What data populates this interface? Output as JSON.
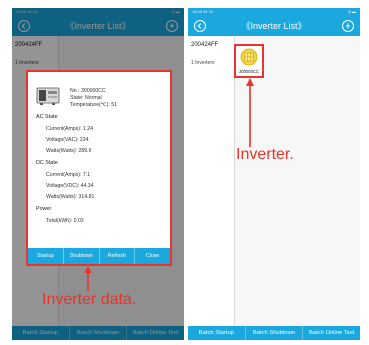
{
  "status_bar": {
    "time": "16:08 54 34 ",
    "right_icons": "· ◘ ▬"
  },
  "title": "《Inverter List》",
  "sidebar": {
    "group_id": "200424FF",
    "count_label": "1 Inverters"
  },
  "dialog": {
    "no": "No.: 300000CC",
    "state": "State: Normal",
    "temperature": "Temperature(℃): 51",
    "ac_state_title": "AC State",
    "ac_current": "Current(Amps): 1.24",
    "ac_voltage": "Voltage(VAC): 234",
    "ac_watts": "Watts(Watts): 289.6",
    "dc_state_title": "DC State",
    "dc_current": "Current(Amps): 7.1",
    "dc_voltage": "Voltage(VDC): 44.34",
    "dc_watts": "Watts(Watts): 314.81",
    "power_title": "Power",
    "total": "Total(kWh): 0.02",
    "buttons": {
      "startup": "Startup",
      "shutdown": "Shutdown",
      "refresh": "Refresh",
      "close": "Close"
    }
  },
  "inverter_tile": {
    "label": "300000CC"
  },
  "bottom_buttons": {
    "batch_startup": "Batch Startup",
    "batch_shutdown": "Batch Shutdown",
    "batch_online_test": "Batch Online Test"
  },
  "annotations": {
    "left": "Inverter data.",
    "right": "Inverter."
  },
  "colors": {
    "title_bar": "#1aa8df",
    "annotation": "#e8342a",
    "tile_icon": "#f2c200"
  }
}
